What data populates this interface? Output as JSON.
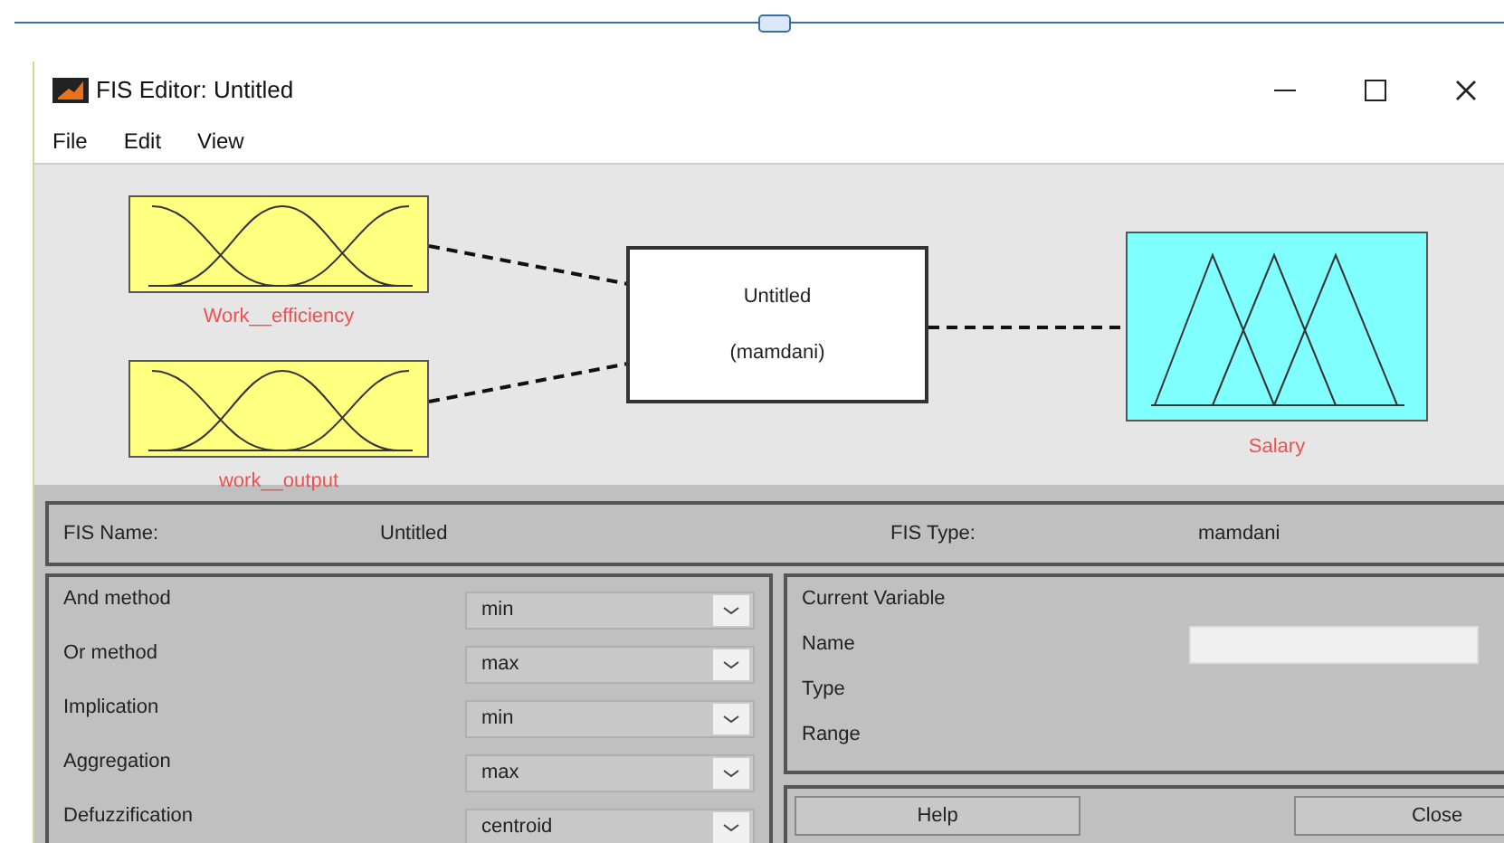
{
  "window": {
    "title": "FIS Editor: Untitled"
  },
  "menu": [
    "File",
    "Edit",
    "View"
  ],
  "inputs": [
    {
      "name": "Work__efficiency"
    },
    {
      "name": "work__output"
    }
  ],
  "system": {
    "name": "Untitled",
    "type": "(mamdani)"
  },
  "output": {
    "name": "Salary"
  },
  "fis_info": [
    {
      "label": "FIS Name:",
      "value": "Untitled"
    },
    {
      "label": "FIS Type:",
      "value": "mamdani"
    }
  ],
  "methods": [
    {
      "label": "And method",
      "value": "min"
    },
    {
      "label": "Or method",
      "value": "max"
    },
    {
      "label": "Implication",
      "value": "min"
    },
    {
      "label": "Aggregation",
      "value": "max"
    },
    {
      "label": "Defuzzification",
      "value": "centroid"
    }
  ],
  "current_variable": {
    "title": "Current Variable",
    "fields": [
      {
        "label": "Name",
        "kind": "input"
      },
      {
        "label": "Type",
        "kind": "text"
      },
      {
        "label": "Range",
        "kind": "text"
      }
    ]
  },
  "buttons": [
    "Help",
    "Close"
  ]
}
